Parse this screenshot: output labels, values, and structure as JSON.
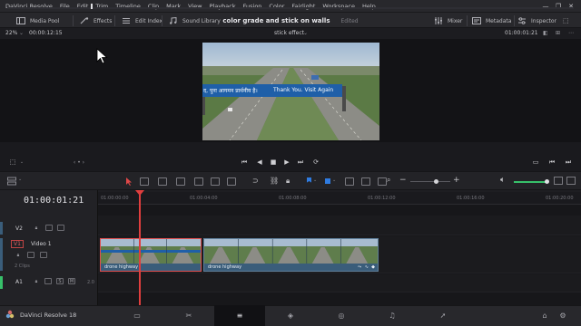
{
  "menubar": {
    "items": [
      "DaVinci Resolve",
      "File",
      "Edit",
      "Trim",
      "Timeline",
      "Clip",
      "Mark",
      "View",
      "Playback",
      "Fusion",
      "Color",
      "Fairlight",
      "Workspace",
      "Help"
    ],
    "window_controls": [
      "—",
      "❐",
      "✕"
    ]
  },
  "toolbar": {
    "media_pool": "Media Pool",
    "effects": "Effects",
    "edit_index": "Edit Index",
    "sound_library": "Sound Library",
    "project_title": "color grade and stick on walls",
    "project_status": "Edited",
    "mixer": "Mixer",
    "metadata": "Metadata",
    "inspector": "Inspector"
  },
  "viewer": {
    "zoom": "22%",
    "source_timecode": "00:00:12:15",
    "timeline_name": "stick effect",
    "timeline_timecode": "01:00:01:21",
    "frame_sign_hindi": "द, पुनः आगमन प्रार्थनीय है।",
    "frame_sign_english": "Thank You. Visit Again"
  },
  "timeline": {
    "timecode": "01:00:01:21",
    "ruler_ticks": [
      "01:00:00:00",
      "01:00:04:00",
      "01:00:08:00",
      "01:00:12:00",
      "01:00:16:00",
      "01:00:20:00"
    ],
    "tracks": {
      "v2": {
        "name": "V2"
      },
      "v1": {
        "name": "V1",
        "label": "Video 1",
        "clip_count": "2 Clips"
      },
      "a1": {
        "name": "A1",
        "channel": "2.0",
        "solo": "S",
        "mute": "M"
      }
    },
    "clips": [
      {
        "name": "drone highway"
      },
      {
        "name": "drone highway"
      }
    ]
  },
  "bottombar": {
    "app_name": "DaVinci Resolve 18"
  },
  "colors": {
    "accent_blue": "#3a5d7a",
    "playhead": "#e03e3e",
    "flag_blue": "#2f7be0",
    "audio_green": "#37c06a"
  }
}
